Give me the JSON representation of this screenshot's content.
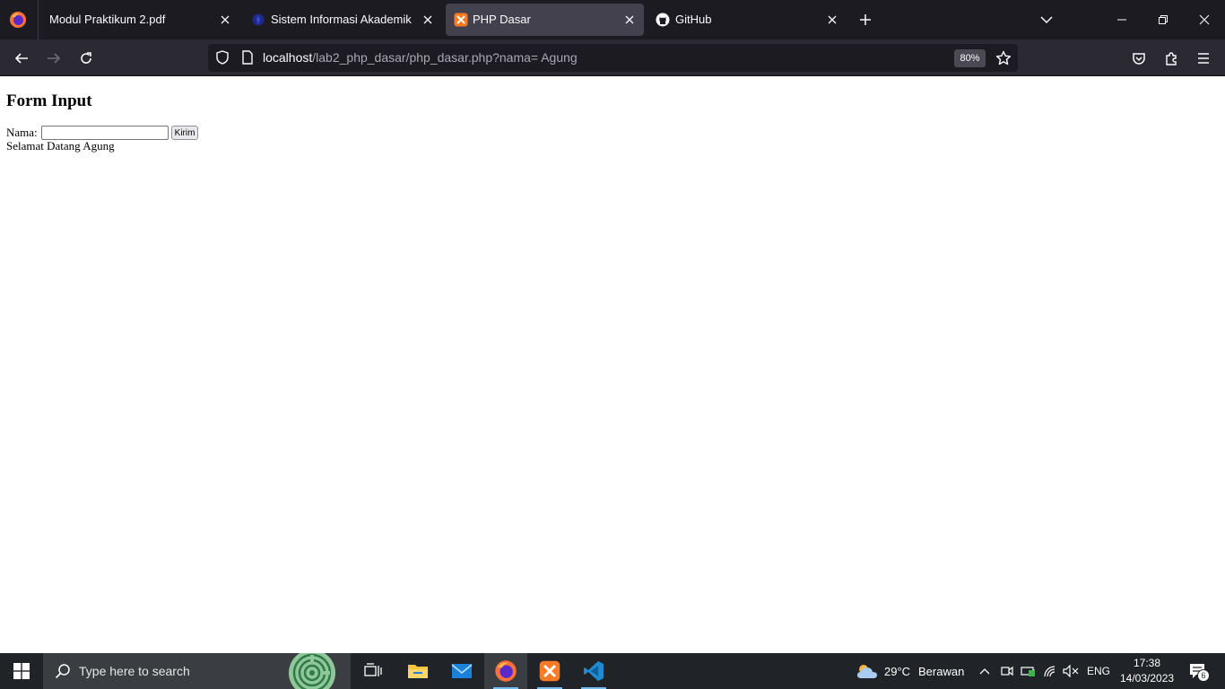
{
  "browser": {
    "tabs": [
      {
        "title": "Modul Praktikum 2.pdf",
        "active": false
      },
      {
        "title": "Sistem Informasi Akademik",
        "active": false
      },
      {
        "title": "PHP Dasar",
        "active": true
      },
      {
        "title": "GitHub",
        "active": false
      }
    ],
    "url_host": "localhost",
    "url_path": "/lab2_php_dasar/php_dasar.php?nama= Agung",
    "zoom": "80%"
  },
  "page": {
    "heading": "Form Input",
    "name_label": "Nama:",
    "name_value": "",
    "submit_label": "Kirim",
    "greeting": "Selamat Datang Agung"
  },
  "taskbar": {
    "search_placeholder": "Type here to search",
    "weather_temp": "29°C",
    "weather_desc": "Berawan",
    "language": "ENG",
    "time": "17:38",
    "date": "14/03/2023",
    "notification_count": "6"
  },
  "colors": {
    "tabstrip_bg": "#1c1b22",
    "navbar_bg": "#2b2a33",
    "active_tab_bg": "#42414d",
    "taskbar_bg": "#202327",
    "accent": "#76b9ed"
  }
}
